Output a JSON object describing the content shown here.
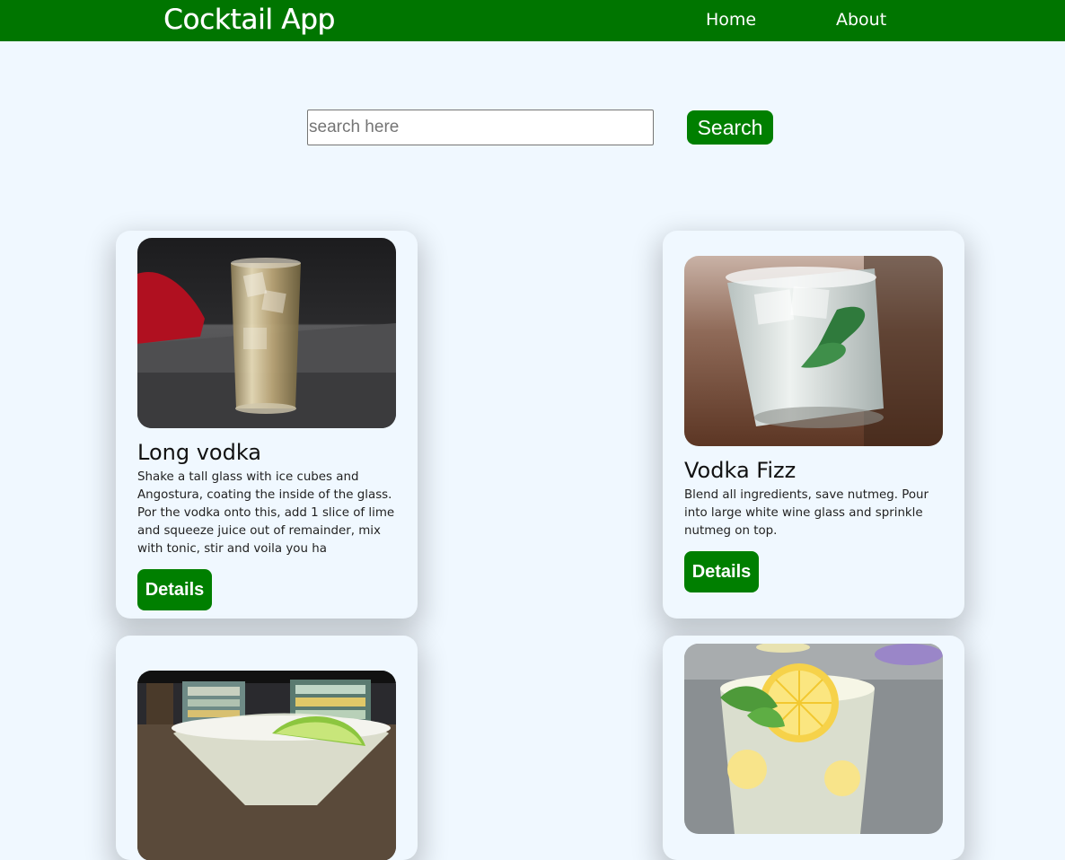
{
  "app": {
    "brand": "Cocktail App",
    "nav": {
      "home": "Home",
      "about": "About"
    },
    "colors": {
      "primary": "#007f00",
      "navbar": "#007500",
      "background": "#f0f8ff"
    }
  },
  "search": {
    "placeholder": "search here",
    "value": "",
    "button_label": "Search"
  },
  "cards": [
    {
      "title": "Long vodka",
      "description": "Shake a tall glass with ice cubes and Angostura, coating the inside of the glass. Por the vodka onto this, add 1 slice of lime and squeeze juice out of remainder, mix with tonic, stir and voila you ha",
      "button_label": "Details",
      "image": "highball-glass-photo"
    },
    {
      "title": "Vodka Fizz",
      "description": "Blend all ingredients, save nutmeg. Pour into large white wine glass and sprinkle nutmeg on top.",
      "button_label": "Details",
      "image": "rocks-glass-mint-photo"
    },
    {
      "title": "",
      "description": "",
      "button_label": "",
      "image": "margarita-glass-lime-photo"
    },
    {
      "title": "",
      "description": "",
      "button_label": "",
      "image": "lemonade-glass-mint-photo"
    }
  ]
}
